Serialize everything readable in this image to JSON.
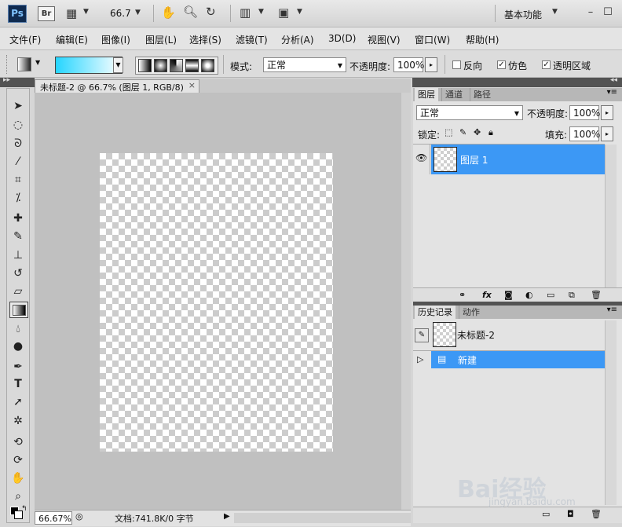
{
  "titlebar": {
    "ps_label": "Ps",
    "br_label": "Br",
    "zoom": "66.7",
    "workspace": "基本功能"
  },
  "menu": [
    "文件(F)",
    "编辑(E)",
    "图像(I)",
    "图层(L)",
    "选择(S)",
    "滤镜(T)",
    "分析(A)",
    "3D(D)",
    "视图(V)",
    "窗口(W)",
    "帮助(H)"
  ],
  "options": {
    "mode_label": "模式:",
    "mode_value": "正常",
    "opacity_label": "不透明度:",
    "opacity_value": "100%",
    "reverse_label": "反向",
    "dither_label": "仿色",
    "transparency_label": "透明区域",
    "reverse_checked": false,
    "dither_checked": true,
    "transparency_checked": true
  },
  "document": {
    "tab_title": "未标题-2 @ 66.7% (图层 1, RGB/8)",
    "close_glyph": "×",
    "zoom_status": "66.67%",
    "doc_info": "文档:741.8K/0 字节"
  },
  "layers_panel": {
    "tabs": [
      "图层",
      "通道",
      "路径"
    ],
    "blend_mode": "正常",
    "opacity_label": "不透明度:",
    "opacity_value": "100%",
    "lock_label": "锁定:",
    "fill_label": "填充:",
    "fill_value": "100%",
    "layers": [
      {
        "name": "图层 1",
        "selected": true,
        "visible": true
      }
    ]
  },
  "history_panel": {
    "tabs": [
      "历史记录",
      "动作"
    ],
    "snapshot_name": "未标题-2",
    "states": [
      {
        "name": "新建",
        "selected": true
      }
    ]
  },
  "watermark": {
    "text": "Bai经验",
    "url": "jingyan.baidu.com"
  },
  "colors": {
    "accent": "#3c98f5",
    "gradient_start": "#25d5ff",
    "gradient_end": "#ffffff"
  }
}
